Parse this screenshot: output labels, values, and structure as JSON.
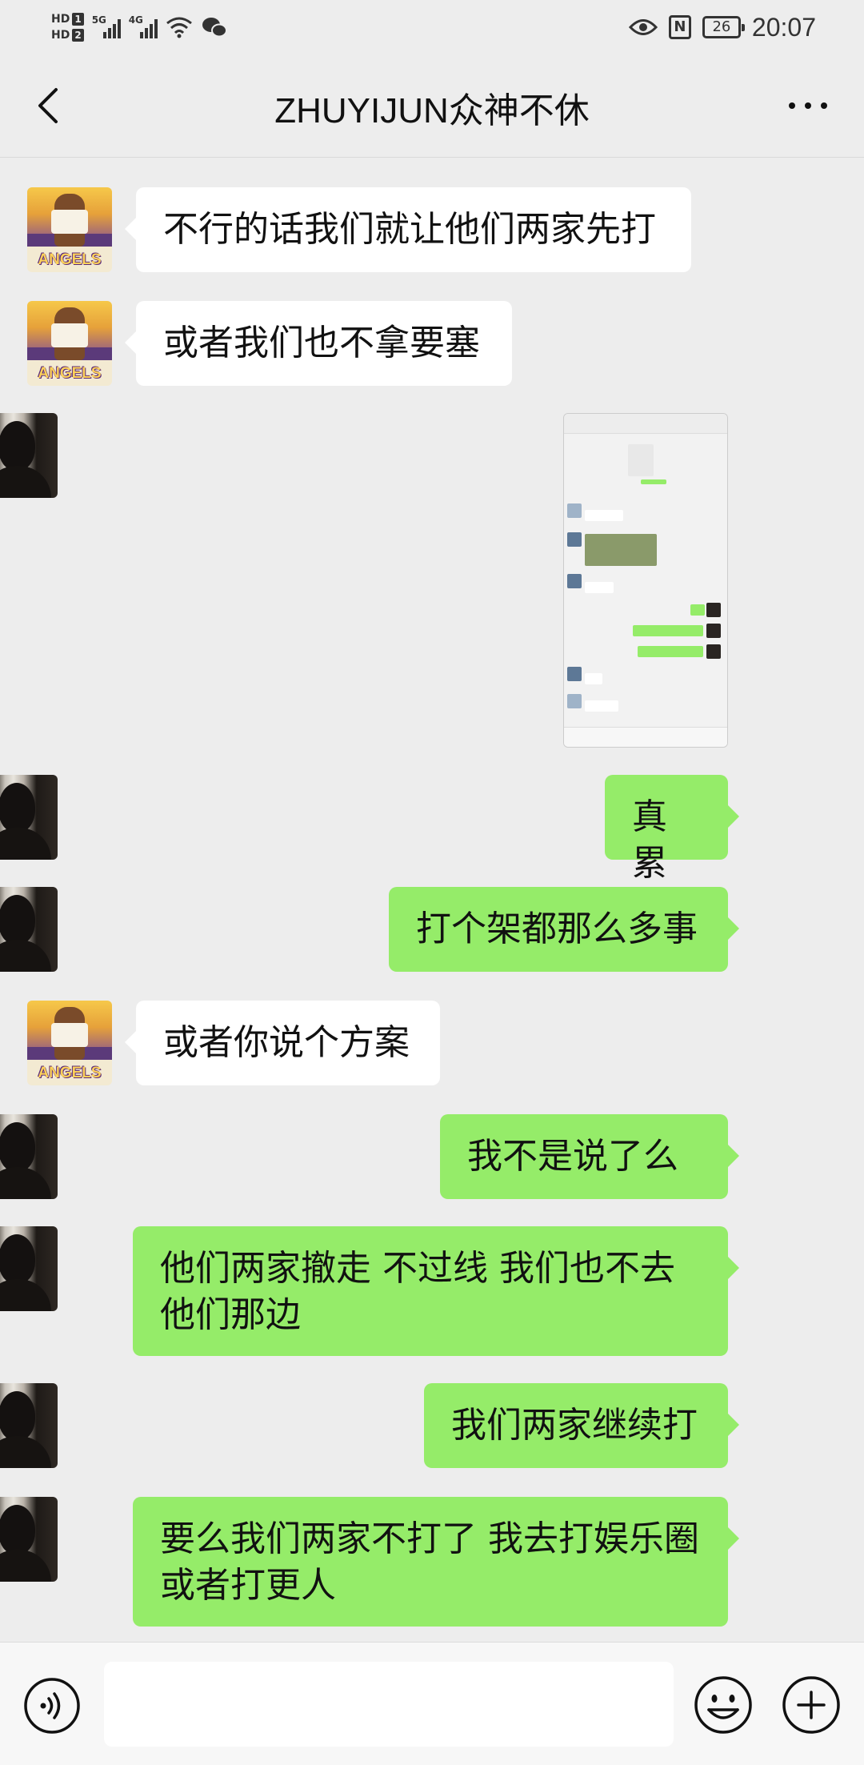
{
  "status_bar": {
    "hd1": "HD",
    "hd1_num": "1",
    "hd2": "HD",
    "hd2_num": "2",
    "net1": "5G",
    "net2": "4G",
    "battery": "26",
    "time": "20:07"
  },
  "header": {
    "title": "ZHUYIJUN众神不休"
  },
  "messages": [
    {
      "side": "in",
      "text": "不行的话我们就让他们两家先打"
    },
    {
      "side": "in",
      "text": "或者我们也不拿要塞"
    },
    {
      "side": "out",
      "type": "image",
      "text": ""
    },
    {
      "side": "out",
      "text": "真累"
    },
    {
      "side": "out",
      "text": "打个架都那么多事"
    },
    {
      "side": "in",
      "text": "或者你说个方案"
    },
    {
      "side": "out",
      "text": "我不是说了么"
    },
    {
      "side": "out",
      "text": "他们两家撤走 不过线 我们也不去他们那边"
    },
    {
      "side": "out",
      "text": "我们两家继续打"
    },
    {
      "side": "out",
      "text": "要么我们两家不打了 我去打娱乐圈或者打更人"
    }
  ],
  "avatar_left_label": "ANGELS",
  "colors": {
    "background": "#ededed",
    "bubble_out": "#95ec69",
    "bubble_in": "#ffffff"
  },
  "icons": [
    "back-arrow-icon",
    "more-icon",
    "voice-icon",
    "emoji-icon",
    "plus-icon"
  ],
  "input": {
    "value": ""
  }
}
